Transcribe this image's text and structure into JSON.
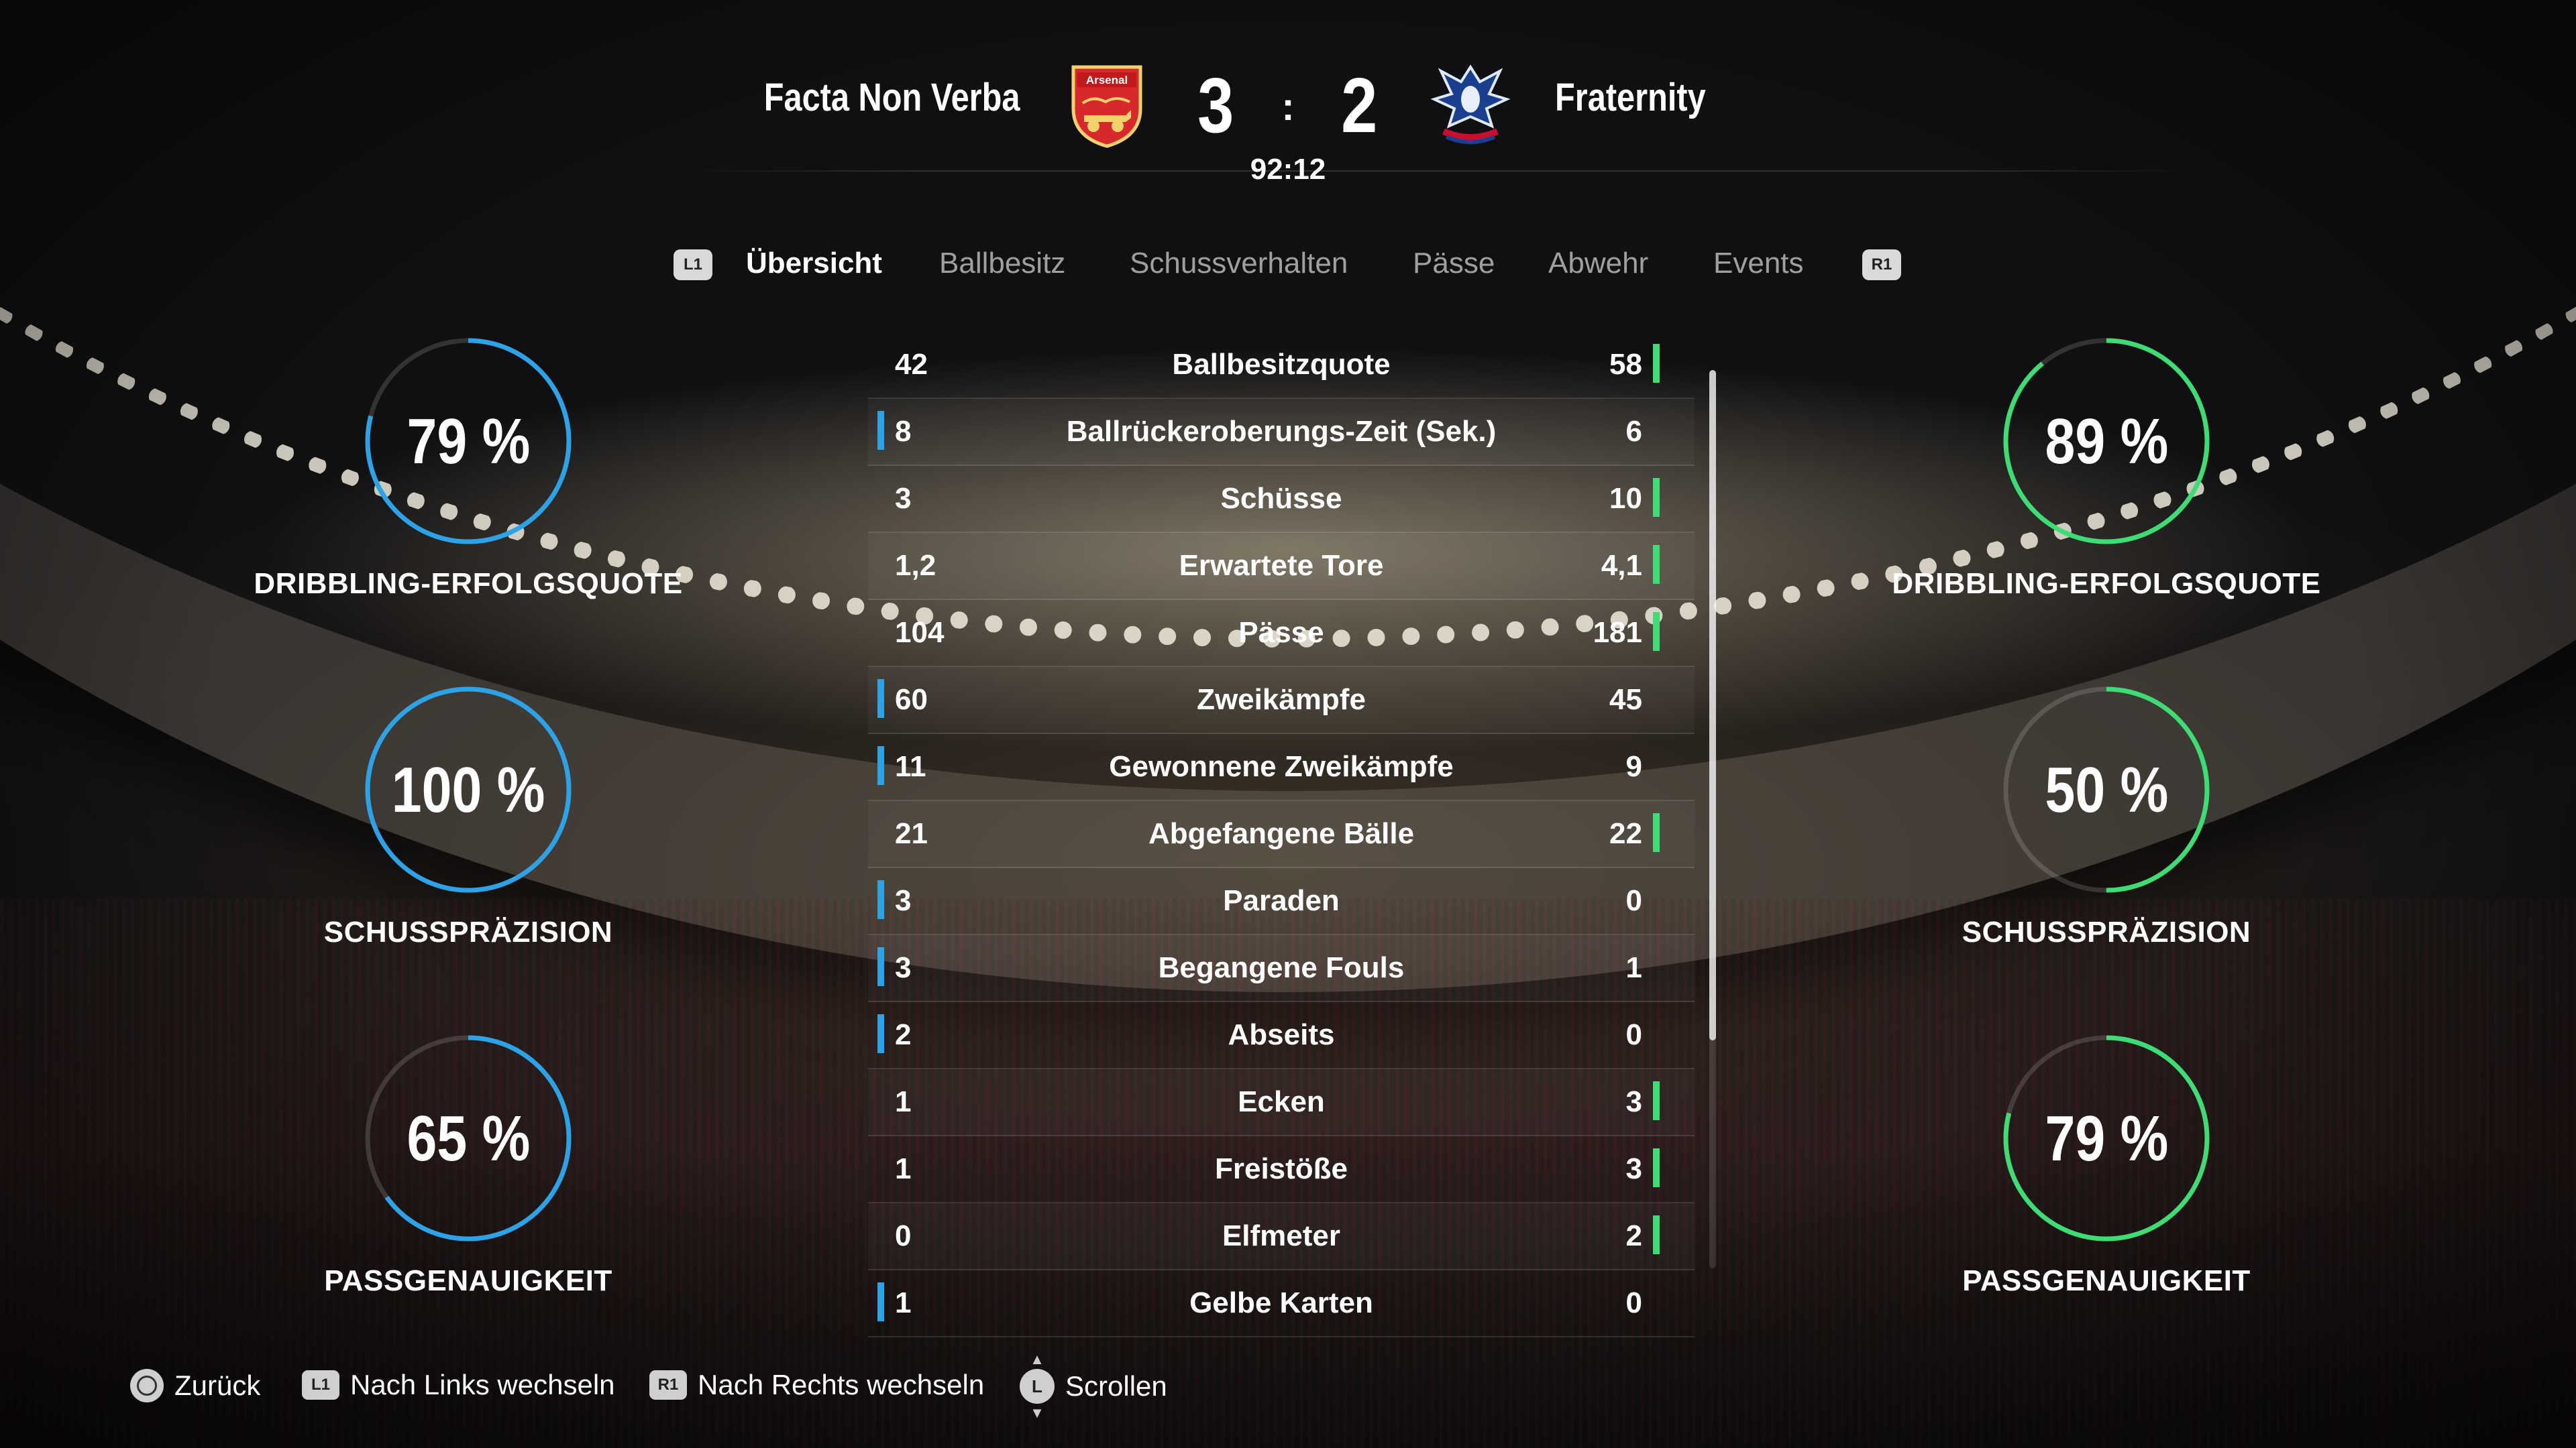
{
  "header": {
    "home_team": "Facta Non Verba",
    "away_team": "Fraternity",
    "home_score": "3",
    "away_score": "2",
    "score_separator": ":",
    "match_time": "92:12",
    "home_crest_text": "Arsenal"
  },
  "tabs": {
    "left_button": "L1",
    "right_button": "R1",
    "items": [
      "Übersicht",
      "Ballbesitz",
      "Schussverhalten",
      "Pässe",
      "Abwehr",
      "Events"
    ],
    "active": "Übersicht"
  },
  "home_gauges": [
    {
      "value": "79 %",
      "pct": 79,
      "label": "DRIBBLING-ERFOLGSQUOTE"
    },
    {
      "value": "100 %",
      "pct": 100,
      "label": "SCHUSSPRÄZISION"
    },
    {
      "value": "65 %",
      "pct": 65,
      "label": "PASSGENAUIGKEIT"
    }
  ],
  "away_gauges": [
    {
      "value": "89 %",
      "pct": 89,
      "label": "DRIBBLING-ERFOLGSQUOTE"
    },
    {
      "value": "50 %",
      "pct": 50,
      "label": "SCHUSSPRÄZISION"
    },
    {
      "value": "79 %",
      "pct": 79,
      "label": "PASSGENAUIGKEIT"
    }
  ],
  "stats": [
    {
      "label": "Ballbesitzquote",
      "home": "42",
      "away": "58",
      "leader": "away"
    },
    {
      "label": "Ballrückeroberungs-Zeit (Sek.)",
      "home": "8",
      "away": "6",
      "leader": "home"
    },
    {
      "label": "Schüsse",
      "home": "3",
      "away": "10",
      "leader": "away"
    },
    {
      "label": "Erwartete Tore",
      "home": "1,2",
      "away": "4,1",
      "leader": "away"
    },
    {
      "label": "Pässe",
      "home": "104",
      "away": "181",
      "leader": "away"
    },
    {
      "label": "Zweikämpfe",
      "home": "60",
      "away": "45",
      "leader": "home"
    },
    {
      "label": "Gewonnene Zweikämpfe",
      "home": "11",
      "away": "9",
      "leader": "home"
    },
    {
      "label": "Abgefangene Bälle",
      "home": "21",
      "away": "22",
      "leader": "away"
    },
    {
      "label": "Paraden",
      "home": "3",
      "away": "0",
      "leader": "home"
    },
    {
      "label": "Begangene Fouls",
      "home": "3",
      "away": "1",
      "leader": "home"
    },
    {
      "label": "Abseits",
      "home": "2",
      "away": "0",
      "leader": "home"
    },
    {
      "label": "Ecken",
      "home": "1",
      "away": "3",
      "leader": "away"
    },
    {
      "label": "Freistöße",
      "home": "1",
      "away": "3",
      "leader": "away"
    },
    {
      "label": "Elfmeter",
      "home": "0",
      "away": "2",
      "leader": "away"
    },
    {
      "label": "Gelbe Karten",
      "home": "1",
      "away": "0",
      "leader": "home"
    }
  ],
  "footer": {
    "back": "Zurück",
    "left_glyph": "L1",
    "left": "Nach Links wechseln",
    "right_glyph": "R1",
    "right": "Nach Rechts wechseln",
    "scroll_glyph": "L",
    "scroll": "Scrollen"
  },
  "colors": {
    "home_accent": "#2ba3e6",
    "away_accent": "#3ddc74"
  },
  "icons": {
    "home_crest": "arsenal-cannon-crest-icon",
    "away_crest": "eagle-crest-icon",
    "back": "circle-button-icon",
    "scroll": "left-stick-icon"
  }
}
